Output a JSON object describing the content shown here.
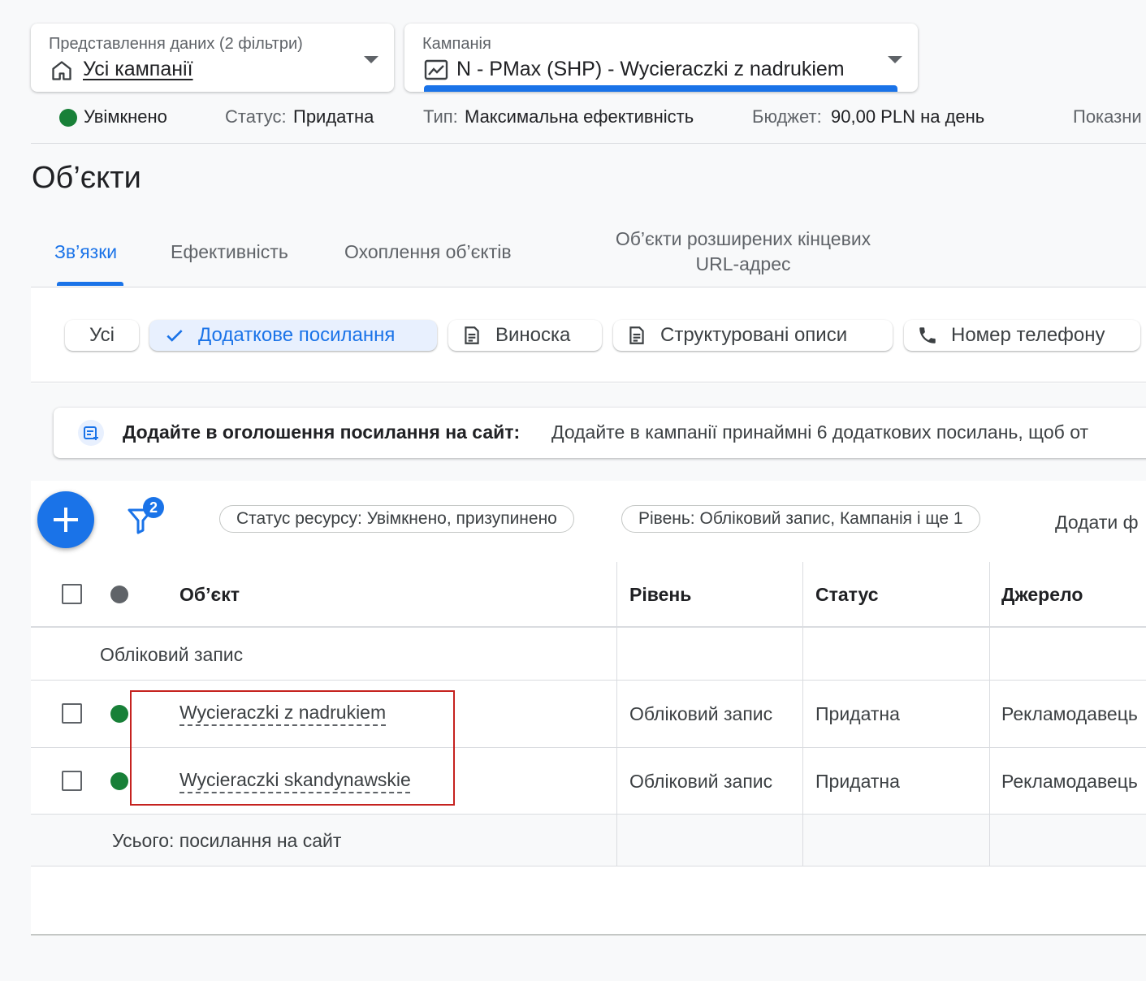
{
  "header": {
    "data_view": {
      "label": "Представлення даних (2 фільтри)",
      "value": "Усі кампанії",
      "icon": "home-icon"
    },
    "campaign": {
      "label": "Кампанія",
      "value": "N - PMax (SHP) - Wycieraczki z nadrukiem",
      "icon": "pmax-campaign-icon"
    }
  },
  "status_bar": {
    "enabled": "Увімкнено",
    "status_label": "Статус:",
    "status_value": "Придатна",
    "type_label": "Тип:",
    "type_value": "Максимальна ефективність",
    "budget_label": "Бюджет:",
    "budget_value": "90,00 PLN на день",
    "metrics_partial": "Показни",
    "enabled_color": "#188038"
  },
  "page_title": "Об’єкти",
  "tabs": [
    {
      "label": "Зв’язки",
      "active": true
    },
    {
      "label": "Ефективність",
      "active": false
    },
    {
      "label": "Охоплення об’єктів",
      "active": false
    },
    {
      "label_line1": "Об’єкти розширених кінцевих",
      "label_line2": "URL-адрес",
      "active": false
    }
  ],
  "chips": [
    {
      "label": "Усі"
    },
    {
      "label": "Додаткове посилання",
      "icon": "check-icon",
      "selected": true
    },
    {
      "label": "Виноска",
      "icon": "document-icon"
    },
    {
      "label": "Структуровані описи",
      "icon": "document-icon"
    },
    {
      "label": "Номер телефону",
      "icon": "phone-icon"
    }
  ],
  "banner": {
    "icon": "add-sitelink-icon",
    "title": "Додайте в оголошення посилання на сайт:",
    "text": "Додайте в кампанії принаймні 6 додаткових посилань, щоб от"
  },
  "toolbar": {
    "filter_count": "2",
    "filters": [
      "Статус ресурсу: Увімкнено, призупинено",
      "Рівень: Обліковий запис, Кампанія і ще 1"
    ],
    "add_filter_partial": "Додати ф"
  },
  "table": {
    "columns": [
      "Об’єкт",
      "Рівень",
      "Статус",
      "Джерело"
    ],
    "group_label": "Обліковий запис",
    "rows": [
      {
        "asset": "Wycieraczki z nadrukiem",
        "level": "Обліковий запис",
        "status": "Придатна",
        "source": "Рекламодавець"
      },
      {
        "asset": "Wycieraczki skandynawskie",
        "level": "Обліковий запис",
        "status": "Придатна",
        "source": "Рекламодавець"
      }
    ],
    "total_label": "Усього: посилання на сайт"
  },
  "colors": {
    "accent": "#1a73e8",
    "enabled_dot": "#188038",
    "highlight": "#c5221f"
  }
}
